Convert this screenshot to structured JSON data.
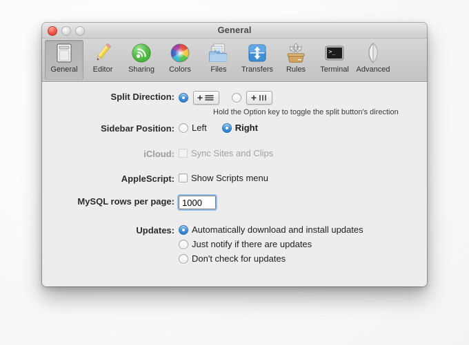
{
  "window": {
    "title": "General",
    "controls": {
      "close": "close-button",
      "minimize": "minimize-button",
      "zoom": "zoom-button"
    }
  },
  "toolbar": {
    "items": [
      {
        "label": "General",
        "icon": "general-icon",
        "selected": true
      },
      {
        "label": "Editor",
        "icon": "editor-icon",
        "selected": false
      },
      {
        "label": "Sharing",
        "icon": "sharing-icon",
        "selected": false
      },
      {
        "label": "Colors",
        "icon": "colors-icon",
        "selected": false
      },
      {
        "label": "Files",
        "icon": "files-icon",
        "selected": false
      },
      {
        "label": "Transfers",
        "icon": "transfers-icon",
        "selected": false
      },
      {
        "label": "Rules",
        "icon": "rules-icon",
        "selected": false
      },
      {
        "label": "Terminal",
        "icon": "terminal-icon",
        "selected": false
      },
      {
        "label": "Advanced",
        "icon": "advanced-icon",
        "selected": false
      }
    ]
  },
  "form": {
    "split_direction": {
      "label": "Split Direction:",
      "option_horizontal": {
        "icon": "split-horizontal-icon",
        "selected": true
      },
      "option_vertical": {
        "icon": "split-vertical-icon",
        "selected": false
      },
      "hint": "Hold the Option key to toggle the split button's direction"
    },
    "sidebar_position": {
      "label": "Sidebar Position:",
      "options": [
        {
          "text": "Left",
          "selected": false
        },
        {
          "text": "Right",
          "selected": true
        }
      ]
    },
    "icloud": {
      "label": "iCloud:",
      "checkbox_text": "Sync Sites and Clips",
      "checked": false,
      "disabled": true
    },
    "applescript": {
      "label": "AppleScript:",
      "checkbox_text": "Show Scripts menu",
      "checked": false,
      "disabled": false
    },
    "mysql_rows": {
      "label": "MySQL rows per page:",
      "value": "1000"
    },
    "updates": {
      "label": "Updates:",
      "options": [
        {
          "text": "Automatically download and install updates",
          "selected": true
        },
        {
          "text": "Just notify if there are updates",
          "selected": false
        },
        {
          "text": "Don't check for updates",
          "selected": false
        }
      ]
    }
  },
  "colors": {
    "accent": "#3e90dd",
    "close_button": "#f2584b",
    "window_bg": "#ededed",
    "toolbar_bg": "#cdcdcd"
  }
}
